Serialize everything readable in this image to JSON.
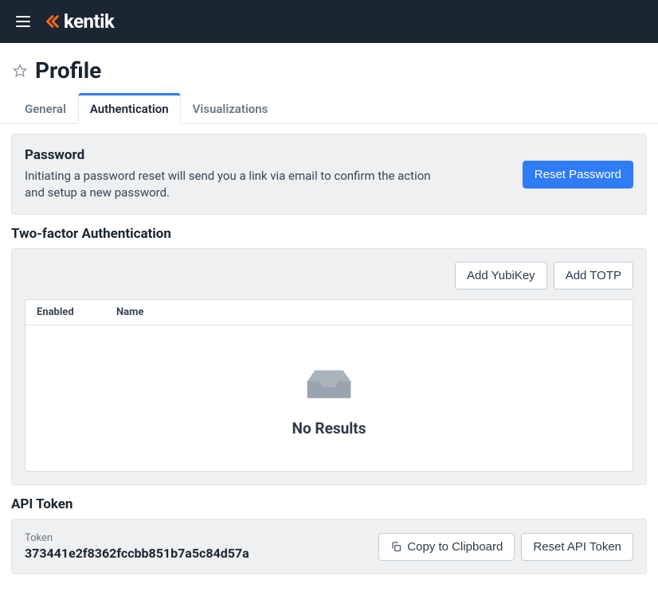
{
  "brand": "kentik",
  "page_title": "Profile",
  "tabs": {
    "general": "General",
    "authentication": "Authentication",
    "visualizations": "Visualizations"
  },
  "password": {
    "title": "Password",
    "text": "Initiating a password reset will send you a link via email to confirm the action and setup a new password.",
    "reset_button": "Reset Password"
  },
  "twofa": {
    "heading": "Two-factor Authentication",
    "add_yubikey": "Add YubiKey",
    "add_totp": "Add TOTP",
    "col_enabled": "Enabled",
    "col_name": "Name",
    "no_results": "No Results"
  },
  "api": {
    "heading": "API Token",
    "label": "Token",
    "value": "373441e2f8362fccbb851b7a5c84d57a",
    "copy_button": "Copy to Clipboard",
    "reset_button": "Reset API Token"
  }
}
